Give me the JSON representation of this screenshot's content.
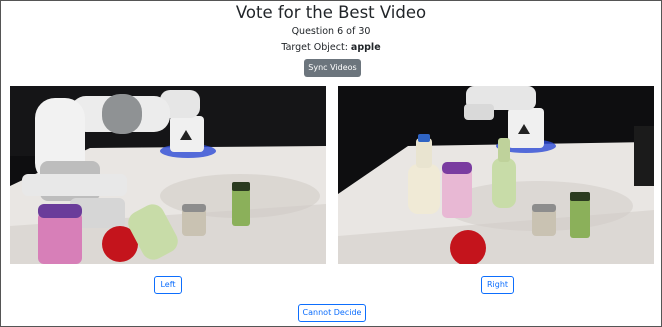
{
  "header": {
    "title": "Vote for the Best Video",
    "question": "Question 6 of 30",
    "target_label": "Target Object: ",
    "target_object": "apple"
  },
  "controls": {
    "sync_label": "Sync Videos",
    "left_label": "Left",
    "right_label": "Right",
    "cannot_decide_label": "Cannot Decide"
  },
  "colors": {
    "sync_button": "#6c757d",
    "choice_button_border": "#0d6efd"
  }
}
